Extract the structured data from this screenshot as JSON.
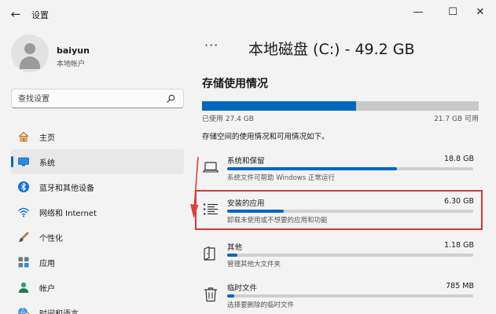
{
  "window": {
    "title": "设置",
    "back_glyph": "←",
    "minimize_glyph": "—",
    "maximize_glyph": "☐",
    "close_glyph": "✕"
  },
  "profile": {
    "name": "baiyun",
    "account_type": "本地帐户"
  },
  "search": {
    "placeholder": "查找设置"
  },
  "nav": {
    "items": [
      {
        "label": "主页",
        "icon": "home-icon"
      },
      {
        "label": "系统",
        "icon": "monitor-icon",
        "selected": true
      },
      {
        "label": "蓝牙和其他设备",
        "icon": "bluetooth-icon"
      },
      {
        "label": "网络和 Internet",
        "icon": "wifi-icon"
      },
      {
        "label": "个性化",
        "icon": "brush-icon"
      },
      {
        "label": "应用",
        "icon": "apps-icon"
      },
      {
        "label": "帐户",
        "icon": "person-icon"
      },
      {
        "label": "时间和语言",
        "icon": "globe-clock-icon"
      }
    ]
  },
  "main": {
    "breadcrumb_more": "···",
    "title": "本地磁盘 (C:) - 49.2 GB",
    "section_title": "存储使用情况",
    "used_label": "已使用 27.4 GB",
    "free_label": "21.7 GB 可用",
    "used_fraction": 0.557,
    "description": "存储空间的使用情况和可用情况如下。",
    "categories": [
      {
        "name": "系统和保留",
        "size": "18.8 GB",
        "desc": "系统文件可帮助 Windows 正常运行",
        "fraction": 0.69,
        "icon": "laptop-icon"
      },
      {
        "name": "安装的应用",
        "size": "6.30 GB",
        "desc": "卸载未使用或不想要的应用和功能",
        "fraction": 0.23,
        "icon": "list-icon"
      },
      {
        "name": "其他",
        "size": "1.18 GB",
        "desc": "管理其他大文件夹",
        "fraction": 0.04,
        "icon": "folder-icon"
      },
      {
        "name": "临时文件",
        "size": "785 MB",
        "desc": "选择要删除的临时文件",
        "fraction": 0.03,
        "icon": "trash-icon"
      }
    ]
  },
  "colors": {
    "accent": "#0067c0",
    "highlight": "#d93737",
    "background": "#f3f3f3"
  }
}
